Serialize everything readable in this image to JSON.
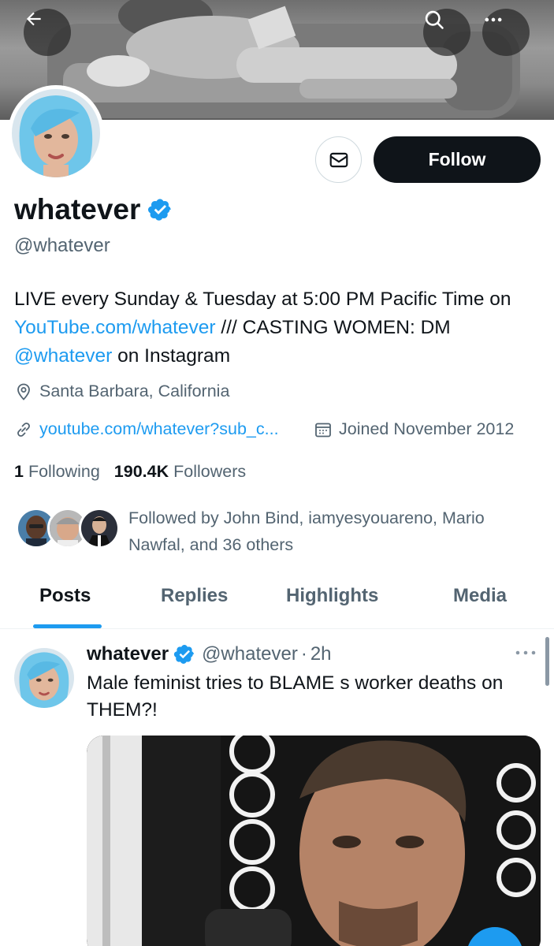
{
  "header": {
    "back_icon": "arrow-left-icon",
    "search_icon": "search-icon",
    "more_icon": "more-horizontal-icon"
  },
  "profile": {
    "display_name": "whatever",
    "handle": "@whatever",
    "verified": true,
    "bio_part1": "LIVE every Sunday & Tuesday at 5:00 PM Pacific Time on ",
    "bio_link1": "YouTube.com/whatever",
    "bio_part2": " /// CASTING WOMEN: DM ",
    "bio_link2": "@whatever",
    "bio_part3": " on Instagram",
    "location": "Santa Barbara, California",
    "website": "youtube.com/whatever?sub_c...",
    "joined": "Joined November 2012",
    "following_count": "1",
    "following_label": "Following",
    "followers_count": "190.4K",
    "followers_label": "Followers",
    "followed_by": "Followed by John Bind, iamyesyouareno, Mario Nawfal, and 36 others"
  },
  "actions": {
    "message_icon": "envelope-icon",
    "follow_label": "Follow"
  },
  "tabs": [
    {
      "label": "Posts",
      "active": true
    },
    {
      "label": "Replies",
      "active": false
    },
    {
      "label": "Highlights",
      "active": false
    },
    {
      "label": "Media",
      "active": false
    }
  ],
  "post": {
    "author_name": "whatever",
    "author_handle": "@whatever",
    "time": "2h",
    "text": "Male feminist tries to BLAME s worker deaths on THEM?!"
  },
  "colors": {
    "accent": "#1d9bf0",
    "text_primary": "#0f1419",
    "text_secondary": "#536471"
  }
}
